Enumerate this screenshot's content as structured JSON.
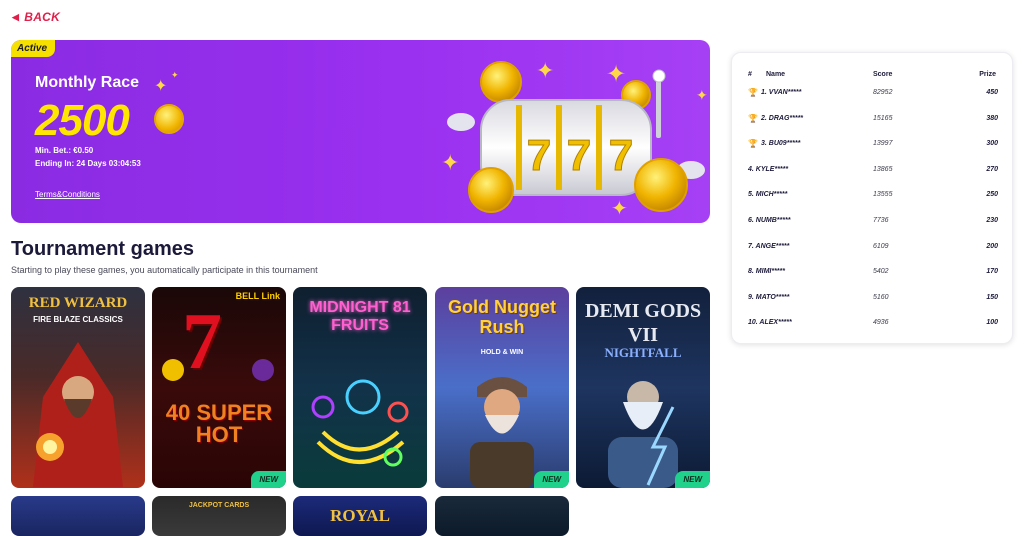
{
  "nav": {
    "back_label": "BACK"
  },
  "race": {
    "status_badge": "Active",
    "title": "Monthly Race",
    "amount": "2500",
    "min_bet": "Min. Bet.: €0.50",
    "ending": "Ending In:  24 Days  03:04:53",
    "terms_label": "Terms&Conditions",
    "art_digits": "777"
  },
  "section": {
    "title": "Tournament games",
    "subtitle": "Starting to play these games, you automatically participate in this tournament"
  },
  "games": [
    {
      "name": "RED WIZARD",
      "subtitle": "FIRE BLAZE CLASSICS",
      "new": ""
    },
    {
      "name": "40 SUPER HOT",
      "subtitle": "BELL Link",
      "new": "NEW"
    },
    {
      "name": "MIDNIGHT 81 FRUITS",
      "subtitle": "",
      "new": ""
    },
    {
      "name": "Gold Nugget Rush",
      "subtitle": "HOLD & WIN",
      "new": "NEW"
    },
    {
      "name": "DEMI GODS VII",
      "subtitle": "NIGHTFALL",
      "new": "NEW"
    }
  ],
  "games_row2": [
    {
      "name": ""
    },
    {
      "name": "JACKPOT CARDS"
    },
    {
      "name": "ROYAL"
    },
    {
      "name": ""
    }
  ],
  "leaderboard": {
    "headers": {
      "rank": "#",
      "name": "Name",
      "score": "Score",
      "prize": "Prize"
    },
    "rows": [
      {
        "rank": "1.",
        "name": "VVAN*****",
        "score": "82952",
        "prize": "450",
        "trophy": true
      },
      {
        "rank": "2.",
        "name": "DRAG*****",
        "score": "15165",
        "prize": "380",
        "trophy": true
      },
      {
        "rank": "3.",
        "name": "BU09*****",
        "score": "13997",
        "prize": "300",
        "trophy": true
      },
      {
        "rank": "4.",
        "name": "KYLE*****",
        "score": "13865",
        "prize": "270",
        "trophy": false
      },
      {
        "rank": "5.",
        "name": "MICH*****",
        "score": "13555",
        "prize": "250",
        "trophy": false
      },
      {
        "rank": "6.",
        "name": "NUMB*****",
        "score": "7736",
        "prize": "230",
        "trophy": false
      },
      {
        "rank": "7.",
        "name": "ANGE*****",
        "score": "6109",
        "prize": "200",
        "trophy": false
      },
      {
        "rank": "8.",
        "name": "MIMI*****",
        "score": "5402",
        "prize": "170",
        "trophy": false
      },
      {
        "rank": "9.",
        "name": "MATO*****",
        "score": "5160",
        "prize": "150",
        "trophy": false
      },
      {
        "rank": "10.",
        "name": "ALEX*****",
        "score": "4936",
        "prize": "100",
        "trophy": false
      }
    ]
  },
  "colors": {
    "accent_red": "#e0204a",
    "banner_purple": "#9a30f0",
    "gold": "#ffe600",
    "new_badge": "#1fd18b",
    "trophy": "#e8b400"
  }
}
